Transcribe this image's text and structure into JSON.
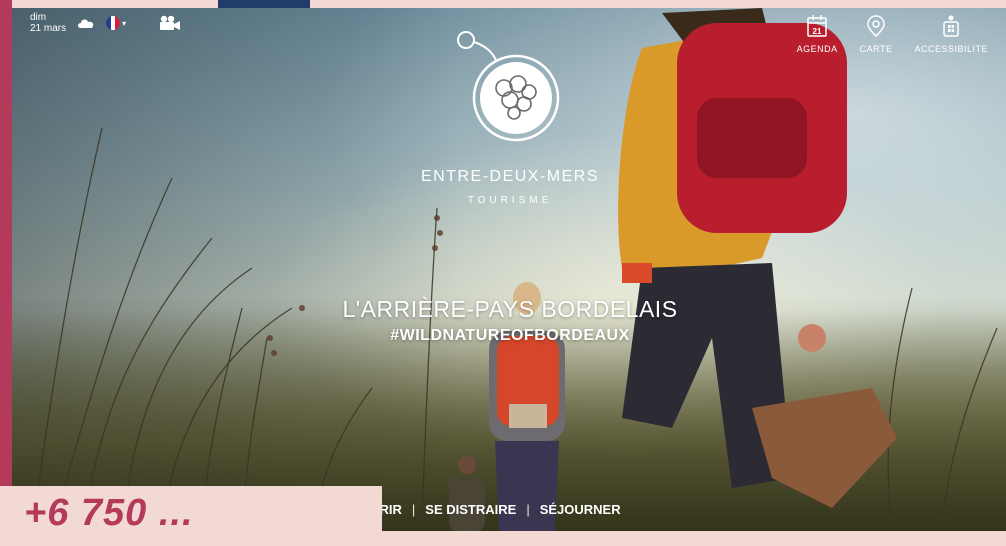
{
  "weather": {
    "date_day": "dim",
    "date_month": "21 mars",
    "icon": "cloud-icon"
  },
  "language": {
    "icon": "french-flag-icon",
    "colors": [
      "#1f3f8f",
      "#ffffff",
      "#d6203a"
    ]
  },
  "nav": {
    "agenda": {
      "label": "AGENDA",
      "day": "21"
    },
    "carte": {
      "label": "CARTE"
    },
    "accessibilite": {
      "label": "ACCESSIBILITE"
    }
  },
  "brand": {
    "name": "ENTRE-DEUX-MERS",
    "subtitle": "TOURISME"
  },
  "hero": {
    "headline": "L'ARRIÈRE-PAYS BORDELAIS",
    "hashtag": "#WILDNATUREOFBORDEAUX"
  },
  "menu": {
    "item1": "...VRIR",
    "sep1": "|",
    "item2": "SE DISTRAIRE",
    "sep2": "|",
    "item3": "SÉJOURNER"
  },
  "overlay": {
    "text": "+6 750 ..."
  },
  "colors": {
    "accent": "#b33a5a",
    "frame": "#f3d9d3",
    "navy": "#1f3d68"
  }
}
